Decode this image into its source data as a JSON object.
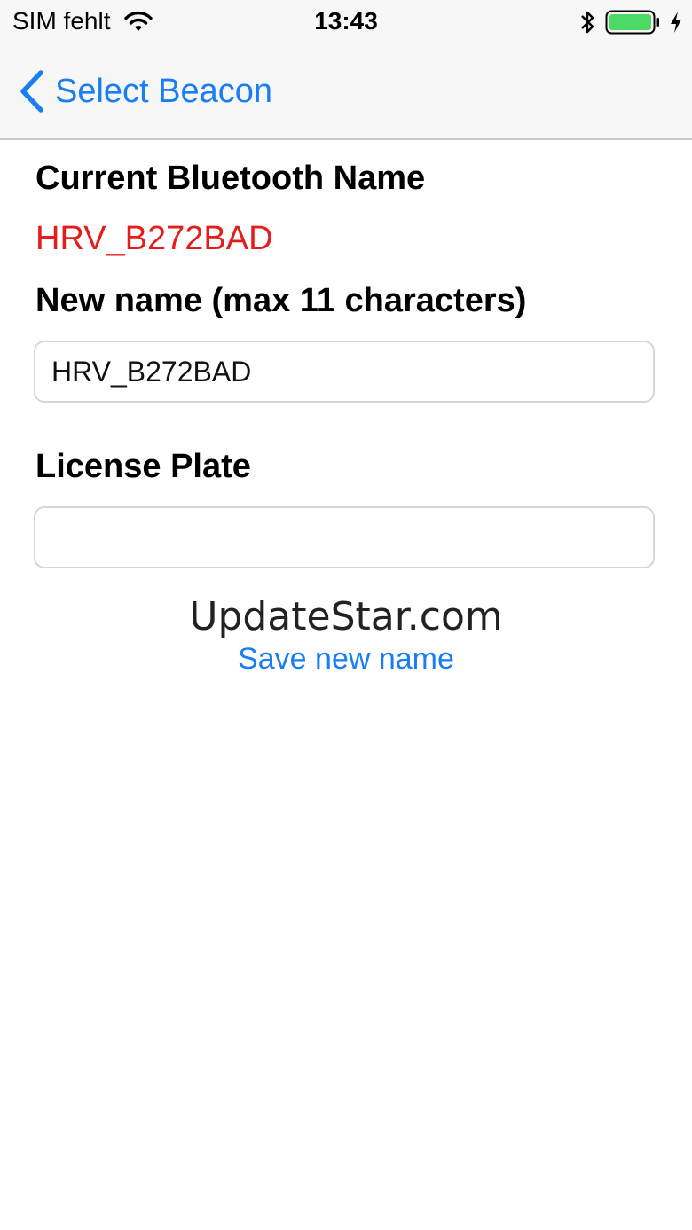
{
  "status_bar": {
    "carrier": "SIM fehlt",
    "time": "13:43",
    "icons": [
      "wifi-icon",
      "bluetooth-icon",
      "battery-icon",
      "charging-icon"
    ]
  },
  "nav": {
    "back_label": "Select Beacon",
    "accent_color": "#1a7ef2"
  },
  "form": {
    "current_label": "Current Bluetooth Name",
    "current_value": "HRV_B272BAD",
    "current_value_color": "#e51c1c",
    "new_name_label": "New name (max 11 characters)",
    "new_name_value": "HRV_B272BAD",
    "license_label": "License Plate",
    "license_value": ""
  },
  "watermark": "UpdateStar.com",
  "save_label": "Save new name"
}
